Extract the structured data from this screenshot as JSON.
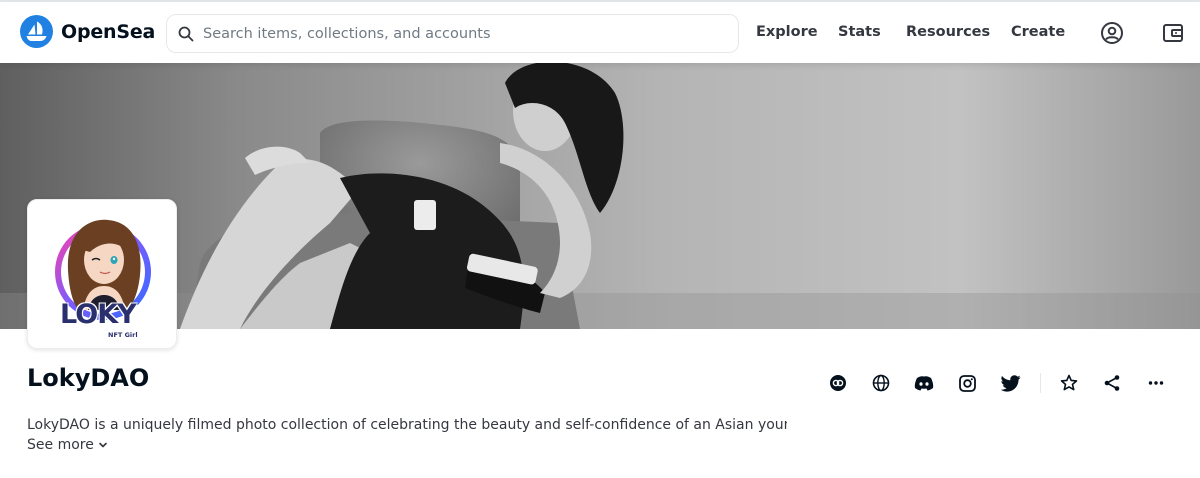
{
  "app": {
    "brand_name": "OpenSea",
    "brand_color": "#2081e2"
  },
  "search": {
    "placeholder": "Search items, collections, and accounts",
    "value": ""
  },
  "nav": {
    "links": [
      "Explore",
      "Stats",
      "Resources",
      "Create"
    ],
    "icons": [
      "account-icon",
      "wallet-icon"
    ]
  },
  "collection": {
    "name": "LokyDAO",
    "description": "LokyDAO is a uniquely filmed photo collection of celebrating the beauty and self-confidence of an Asian young…",
    "see_more_label": "See more",
    "avatar_text": "LOKY",
    "avatar_subtext": "NFT Girl"
  },
  "actions": {
    "icons": [
      "website-icon",
      "globe-icon",
      "discord-icon",
      "instagram-icon",
      "twitter-icon",
      "star-icon",
      "share-icon",
      "more-icon"
    ]
  }
}
